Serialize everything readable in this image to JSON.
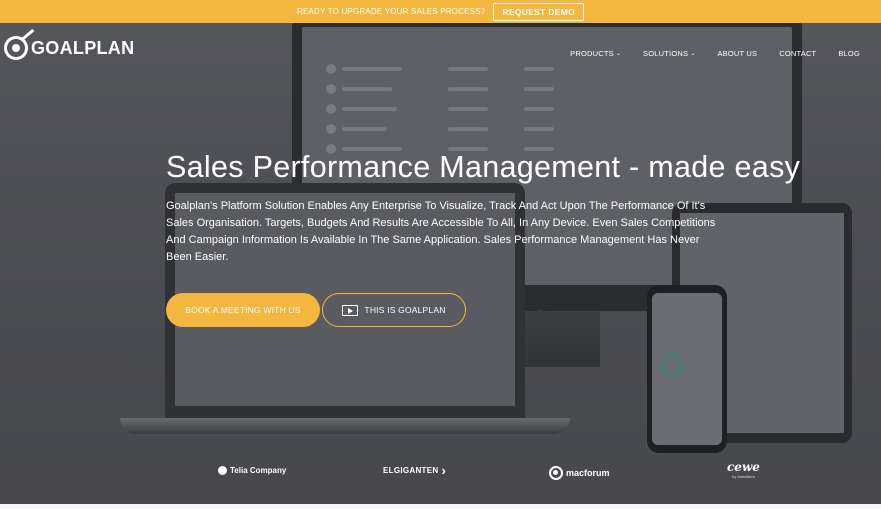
{
  "topbar": {
    "text": "READY TO UPGRADE YOUR SALES PROCESS?",
    "button": "REQUEST DEMO"
  },
  "brand": {
    "name": "GOALPLAN",
    "icon": "goalplan-logo-icon"
  },
  "nav": {
    "items": [
      {
        "label": "PRODUCTS",
        "has_dropdown": true
      },
      {
        "label": "SOLUTIONS",
        "has_dropdown": true
      },
      {
        "label": "ABOUT US",
        "has_dropdown": false
      },
      {
        "label": "CONTACT",
        "has_dropdown": false
      },
      {
        "label": "BLOG",
        "has_dropdown": false
      }
    ],
    "chevron": "⌄"
  },
  "hero": {
    "title": "Sales Performance Management - made easy",
    "description": "Goalplan's Platform Solution Enables Any Enterprise To Visualize, Track And Act Upon The Performance Of It's Sales Organisation. Targets, Budgets And Results Are Accessible To All, In Any Device. Even Sales Competitions And Campaign Information Is Available In The Same Application. Sales Performance Management Has Never Been Easier.",
    "primary_button": "BOOK A MEETING WITH US",
    "secondary_button": "THIS IS GOALPLAN",
    "secondary_icon": "video-icon"
  },
  "clients": {
    "telia": "Telia Company",
    "elgiganten": "ELGIGANTEN",
    "macforum": "macforum",
    "cewe": "cewe",
    "cewe_sub": "by zwedform"
  },
  "colors": {
    "accent": "#f3b73f",
    "background": "#4a4b50",
    "text": "#ffffff"
  }
}
